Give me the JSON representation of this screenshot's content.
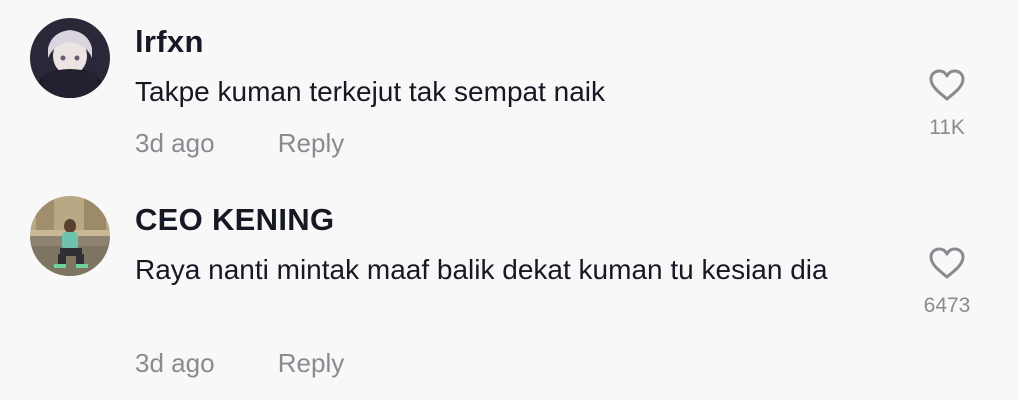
{
  "comments": [
    {
      "username": "lrfxn",
      "text": "Takpe kuman terkejut tak sempat naik",
      "time": "3d ago",
      "reply_label": "Reply",
      "like_count": "11K",
      "avatar_icon": "anime-avatar-icon"
    },
    {
      "username": "CEO KENING",
      "text": "Raya nanti mintak maaf balik dekat kuman tu kesian dia",
      "time": "3d ago",
      "reply_label": "Reply",
      "like_count": "6473",
      "avatar_icon": "photo-avatar-icon"
    }
  ],
  "colors": {
    "background": "#f8f8f8",
    "text": "#161823",
    "secondary": "#8a8b91"
  }
}
